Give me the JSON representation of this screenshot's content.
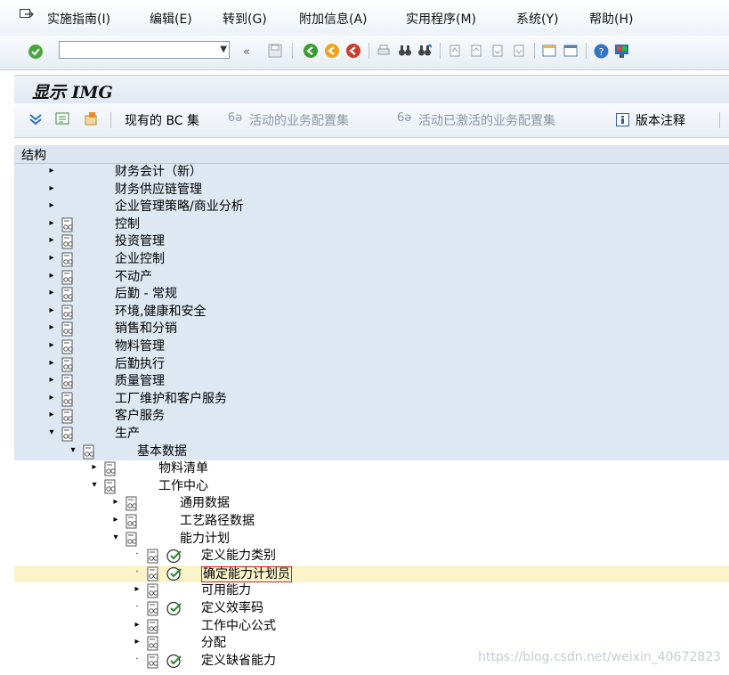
{
  "menubar": {
    "items": [
      "实施指南(I)",
      "编辑(E)",
      "转到(G)",
      "附加信息(A)",
      "实用程序(M)",
      "系统(Y)",
      "帮助(H)"
    ]
  },
  "toolbar": {
    "command_field_value": "",
    "back_label": "«"
  },
  "screen": {
    "title": "显示 IMG"
  },
  "app_toolbar": {
    "bc_sets": "现有的 BC 集",
    "active_bc_sets": "活动的业务配置集",
    "activated_bc_sets": "活动已激活的业务配置集",
    "release_notes": "版本注释"
  },
  "tree": {
    "header": "结构",
    "rows": [
      {
        "label": "财务会计（新）",
        "toggle": "▸",
        "doc": false,
        "exec": false
      },
      {
        "label": "财务供应链管理",
        "toggle": "▸",
        "doc": false,
        "exec": false
      },
      {
        "label": "企业管理策略/商业分析",
        "toggle": "▸",
        "doc": false,
        "exec": false
      },
      {
        "label": "控制",
        "toggle": "▸",
        "doc": true,
        "exec": false
      },
      {
        "label": "投资管理",
        "toggle": "▸",
        "doc": true,
        "exec": false
      },
      {
        "label": "企业控制",
        "toggle": "▸",
        "doc": true,
        "exec": false
      },
      {
        "label": "不动产",
        "toggle": "▸",
        "doc": true,
        "exec": false
      },
      {
        "label": "后勤 - 常规",
        "toggle": "▸",
        "doc": true,
        "exec": false
      },
      {
        "label": "环境,健康和安全",
        "toggle": "▸",
        "doc": true,
        "exec": false
      },
      {
        "label": "销售和分销",
        "toggle": "▸",
        "doc": true,
        "exec": false
      },
      {
        "label": "物料管理",
        "toggle": "▸",
        "doc": true,
        "exec": false
      },
      {
        "label": "后勤执行",
        "toggle": "▸",
        "doc": true,
        "exec": false
      },
      {
        "label": "质量管理",
        "toggle": "▸",
        "doc": true,
        "exec": false
      },
      {
        "label": "工厂维护和客户服务",
        "toggle": "▸",
        "doc": true,
        "exec": false
      },
      {
        "label": "客户服务",
        "toggle": "▸",
        "doc": true,
        "exec": false
      },
      {
        "label": "生产",
        "toggle": "▾",
        "doc": true,
        "exec": false
      },
      {
        "label": "基本数据",
        "toggle": "▾",
        "doc": true,
        "exec": false
      },
      {
        "label": "物料清单",
        "toggle": "▸",
        "doc": true,
        "exec": false
      },
      {
        "label": "工作中心",
        "toggle": "▾",
        "doc": true,
        "exec": false
      },
      {
        "label": "通用数据",
        "toggle": "▸",
        "doc": true,
        "exec": false
      },
      {
        "label": "工艺路径数据",
        "toggle": "▸",
        "doc": true,
        "exec": false
      },
      {
        "label": "能力计划",
        "toggle": "▾",
        "doc": true,
        "exec": false
      },
      {
        "label": "定义能力类别",
        "toggle": "·",
        "doc": true,
        "exec": true
      },
      {
        "label": "确定能力计划员",
        "toggle": "·",
        "doc": true,
        "exec": true,
        "selected": true
      },
      {
        "label": "可用能力",
        "toggle": "▸",
        "doc": true,
        "exec": false
      },
      {
        "label": "定义效率码",
        "toggle": "·",
        "doc": true,
        "exec": true
      },
      {
        "label": "工作中心公式",
        "toggle": "▸",
        "doc": true,
        "exec": false
      },
      {
        "label": "分配",
        "toggle": "▸",
        "doc": true,
        "exec": false
      },
      {
        "label": "定义缺省能力",
        "toggle": "·",
        "doc": true,
        "exec": true
      }
    ]
  },
  "watermark": "https://blog.csdn.net/weixin_40672823"
}
